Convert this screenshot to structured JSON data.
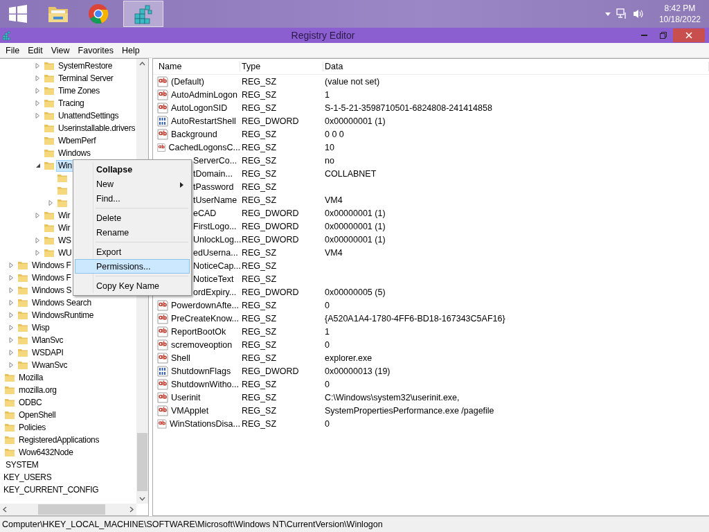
{
  "taskbar": {
    "apps": [
      {
        "kind": "start",
        "selected": false
      },
      {
        "kind": "folder",
        "selected": false
      },
      {
        "kind": "browser",
        "selected": false
      },
      {
        "kind": "registry",
        "selected": true
      }
    ],
    "time": "8:42 PM",
    "date": "10/18/2022"
  },
  "window": {
    "title": "Registry Editor"
  },
  "menu_bar": [
    "File",
    "Edit",
    "View",
    "Favorites",
    "Help"
  ],
  "tree": [
    [
      [
        [
          [
            [
              {
                "label": "SystemRestore",
                "expanded": false,
                "folder": true,
                "selected": false
              },
              {
                "label": "Terminal Server",
                "expanded": false,
                "folder": true,
                "selected": false
              },
              {
                "label": "Time Zones",
                "expanded": false,
                "folder": true,
                "selected": false
              },
              {
                "label": "Tracing",
                "expanded": false,
                "folder": true,
                "selected": false
              },
              {
                "label": "UnattendSettings",
                "expanded": false,
                "folder": true,
                "selected": false
              },
              {
                "label": "Userinstallable.drivers",
                "folder": true,
                "selected": false
              },
              {
                "label": "WbemPerf",
                "folder": true,
                "selected": false
              },
              {
                "label": "Windows",
                "folder": true,
                "selected": false
              },
              {
                "label": "Win",
                "expanded": true,
                "folder": true,
                "selected": true,
                "children": [
                  {
                    "folder": true
                  },
                  {
                    "folder": true
                  },
                  {
                    "expanded": false,
                    "folder": true
                  }
                ]
              },
              {
                "label": "Wir",
                "expanded": false,
                "folder": true,
                "selected": false
              },
              {
                "label": "Wir",
                "folder": true,
                "selected": false
              },
              {
                "label": "WS",
                "expanded": false,
                "folder": true,
                "selected": false
              },
              {
                "label": "WU",
                "expanded": false,
                "folder": true,
                "selected": false
              }
            ]
          ],
          {
            "label": "Windows F",
            "expanded": false,
            "folder": true,
            "selected": false
          },
          {
            "label": "Windows F",
            "expanded": false,
            "folder": true,
            "selected": false
          },
          {
            "label": "Windows S",
            "expanded": false,
            "folder": true,
            "selected": false
          },
          {
            "label": "Windows Search",
            "expanded": false,
            "folder": true,
            "selected": false
          },
          {
            "label": "WindowsRuntime",
            "expanded": false,
            "folder": true,
            "selected": false
          },
          {
            "label": "Wisp",
            "expanded": false,
            "folder": true,
            "selected": false
          },
          {
            "label": "WlanSvc",
            "expanded": false,
            "folder": true,
            "selected": false
          },
          {
            "label": "WSDAPI",
            "expanded": false,
            "folder": true,
            "selected": false
          },
          {
            "label": "WwanSvc",
            "expanded": false,
            "folder": true,
            "selected": false
          }
        ],
        {
          "label": "Mozilla",
          "folder": true,
          "selected": false
        },
        {
          "label": "mozilla.org",
          "folder": true,
          "selected": false
        },
        {
          "label": "ODBC",
          "folder": true,
          "selected": false
        },
        {
          "label": "OpenShell",
          "folder": true,
          "selected": false
        },
        {
          "label": "Policies",
          "folder": true,
          "selected": false
        },
        {
          "label": "RegisteredApplications",
          "folder": true,
          "selected": false
        },
        {
          "label": "Wow6432Node",
          "folder": true,
          "selected": false
        }
      ],
      {
        "label": "SYSTEM",
        "folder": false,
        "selected": false
      }
    ],
    {
      "label": "KEY_USERS",
      "selected": false
    },
    {
      "label": "KEY_CURRENT_CONFIG",
      "selected": false
    }
  ],
  "values": {
    "columns": [
      "Name",
      "Type",
      "Data"
    ],
    "rows": [
      {
        "kind": "string",
        "name": "(Default)",
        "type": "REG_SZ",
        "data": "(value not set)"
      },
      {
        "kind": "string",
        "name": "AutoAdminLogon",
        "type": "REG_SZ",
        "data": "1"
      },
      {
        "kind": "string",
        "name": "AutoLogonSID",
        "type": "REG_SZ",
        "data": "S-1-5-21-3598710501-6824808-241414858"
      },
      {
        "kind": "binary",
        "name": "AutoRestartShell",
        "type": "REG_DWORD",
        "data": "0x00000001 (1)"
      },
      {
        "kind": "string",
        "name": "Background",
        "type": "REG_SZ",
        "data": "0 0 0"
      },
      {
        "kind": "string",
        "name": "CachedLogonsC...",
        "type": "REG_SZ",
        "data": "10"
      },
      {
        "kind": "covered",
        "name": "ServerCo...",
        "type": "REG_SZ",
        "data": "no"
      },
      {
        "kind": "covered",
        "name": "tDomain...",
        "type": "REG_SZ",
        "data": "COLLABNET"
      },
      {
        "kind": "covered",
        "name": "tPassword",
        "type": "REG_SZ"
      },
      {
        "kind": "covered",
        "name": "tUserName",
        "type": "REG_SZ",
        "data": "VM4"
      },
      {
        "kind": "covered",
        "name": "eCAD",
        "type": "REG_DWORD",
        "data": "0x00000001 (1)"
      },
      {
        "kind": "covered",
        "name": "FirstLogo...",
        "type": "REG_DWORD",
        "data": "0x00000001 (1)"
      },
      {
        "kind": "covered",
        "name": "UnlockLog...",
        "type": "REG_DWORD",
        "data": "0x00000001 (1)"
      },
      {
        "kind": "covered",
        "name": "edUserna...",
        "type": "REG_SZ",
        "data": "VM4"
      },
      {
        "kind": "covered",
        "name": "NoticeCap...",
        "type": "REG_SZ"
      },
      {
        "kind": "covered",
        "name": "NoticeText",
        "type": "REG_SZ"
      },
      {
        "kind": "covered",
        "name": "ordExpiry...",
        "type": "REG_DWORD",
        "data": "0x00000005 (5)"
      },
      {
        "kind": "string",
        "name": "PowerdownAfte...",
        "type": "REG_SZ",
        "data": "0"
      },
      {
        "kind": "string",
        "name": "PreCreateKnow...",
        "type": "REG_SZ",
        "data": "{A520A1A4-1780-4FF6-BD18-167343C5AF16}"
      },
      {
        "kind": "string",
        "name": "ReportBootOk",
        "type": "REG_SZ",
        "data": "1"
      },
      {
        "kind": "string",
        "name": "scremoveoption",
        "type": "REG_SZ",
        "data": "0"
      },
      {
        "kind": "string",
        "name": "Shell",
        "type": "REG_SZ",
        "data": "explorer.exe"
      },
      {
        "kind": "binary",
        "name": "ShutdownFlags",
        "type": "REG_DWORD",
        "data": "0x00000013 (19)"
      },
      {
        "kind": "string",
        "name": "ShutdownWitho...",
        "type": "REG_SZ",
        "data": "0"
      },
      {
        "kind": "string",
        "name": "Userinit",
        "type": "REG_SZ",
        "data": "C:\\Windows\\system32\\userinit.exe,"
      },
      {
        "kind": "string",
        "name": "VMApplet",
        "type": "REG_SZ",
        "data": "SystemPropertiesPerformance.exe /pagefile"
      },
      {
        "kind": "string",
        "name": "WinStationsDisa...",
        "type": "REG_SZ",
        "data": "0"
      }
    ]
  },
  "context_menu": [
    {
      "kind": "item",
      "label": "Collapse",
      "default": true,
      "submenu": false,
      "selected": false
    },
    {
      "kind": "item",
      "label": "New",
      "default": false,
      "submenu": true,
      "selected": false
    },
    {
      "kind": "item",
      "label": "Find...",
      "default": false,
      "submenu": false,
      "selected": false
    },
    {
      "kind": "separator"
    },
    {
      "kind": "item",
      "label": "Delete",
      "default": false,
      "submenu": false,
      "selected": false
    },
    {
      "kind": "item",
      "label": "Rename",
      "default": false,
      "submenu": false,
      "selected": false
    },
    {
      "kind": "separator"
    },
    {
      "kind": "item",
      "label": "Export",
      "default": false,
      "submenu": false,
      "selected": false
    },
    {
      "kind": "item",
      "label": "Permissions...",
      "default": false,
      "submenu": false,
      "selected": true
    },
    {
      "kind": "separator"
    },
    {
      "kind": "item",
      "label": "Copy Key Name",
      "default": false,
      "submenu": false,
      "selected": false
    }
  ],
  "status_bar": "Computer\\HKEY_LOCAL_MACHINE\\SOFTWARE\\Microsoft\\Windows NT\\CurrentVersion\\Winlogon"
}
